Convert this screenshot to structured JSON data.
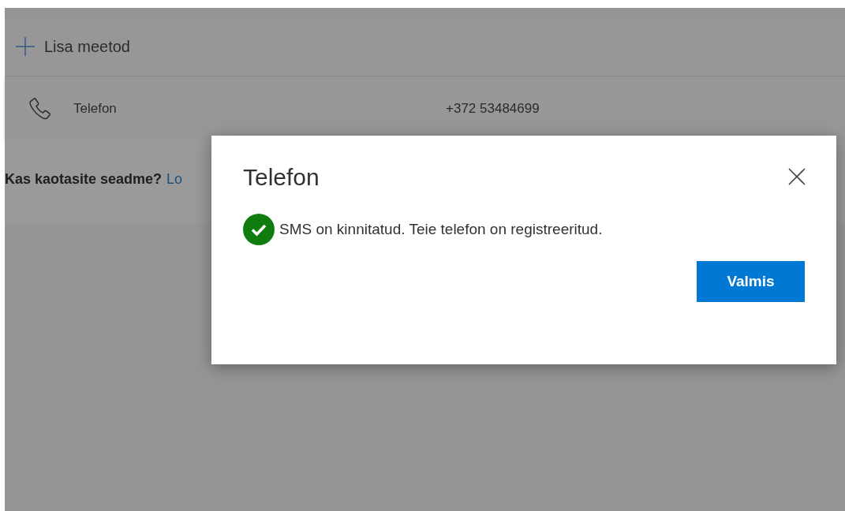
{
  "add_method": {
    "label": "Lisa meetod"
  },
  "methods": [
    {
      "name": "Telefon",
      "value": "+372 53484699"
    }
  ],
  "lost_device": {
    "question": "Kas kaotasite seadme?",
    "link": "Lo"
  },
  "dialog": {
    "title": "Telefon",
    "message": "SMS on kinnitatud. Teie telefon on registreeritud.",
    "button": "Valmis"
  }
}
